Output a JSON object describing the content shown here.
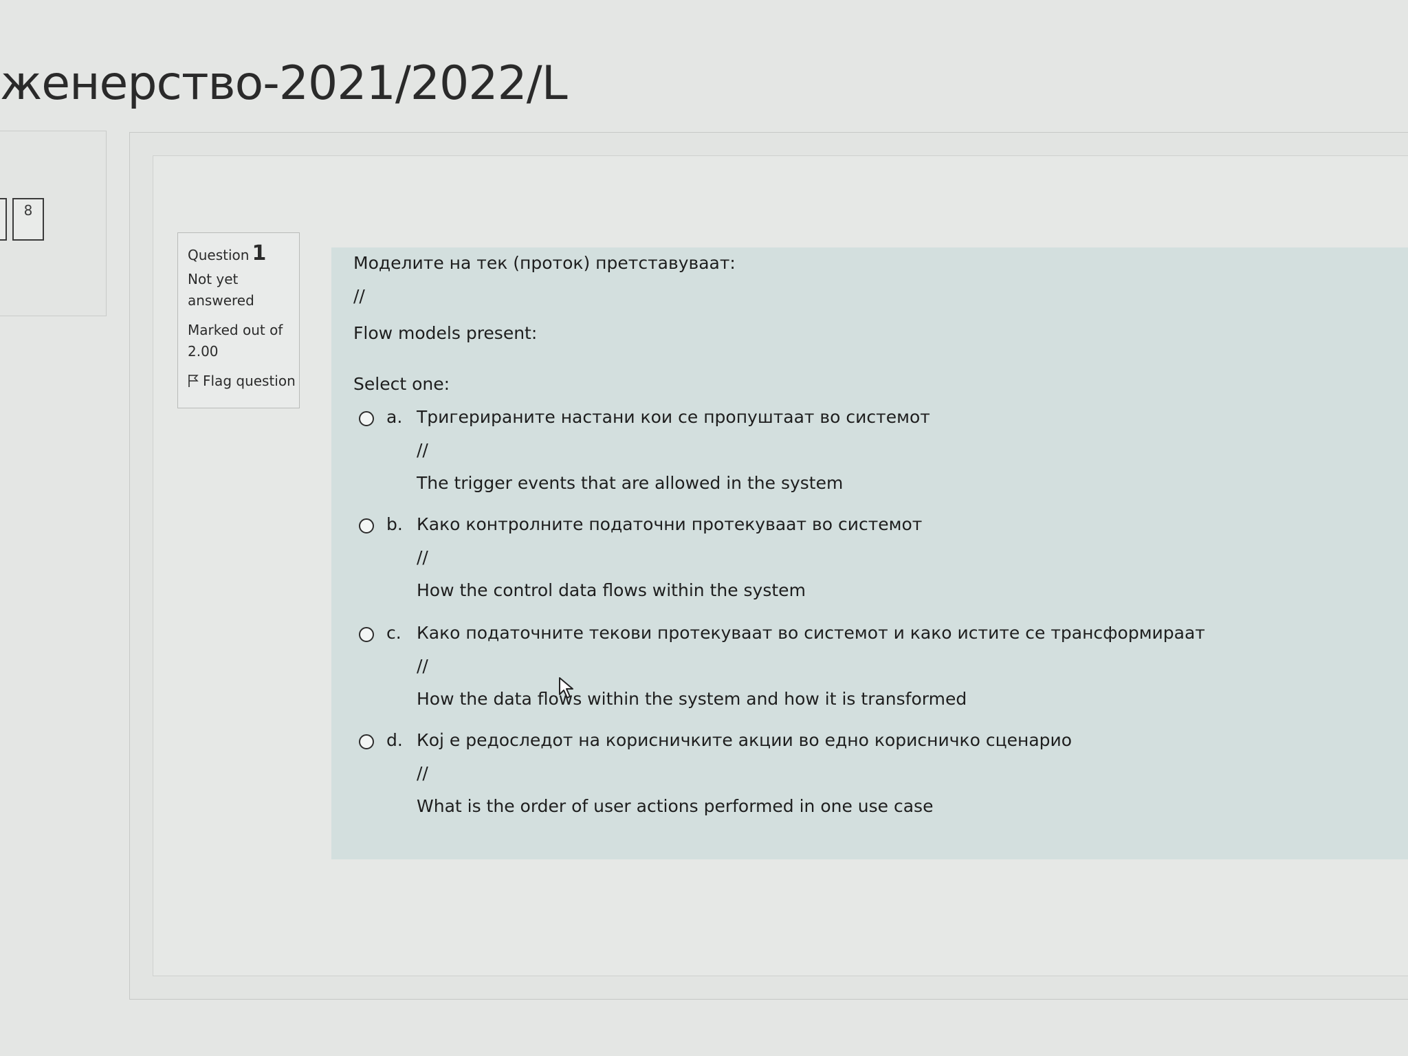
{
  "page": {
    "title": "женерство-2021/2022/L"
  },
  "quiz_nav": {
    "buttons": [
      {
        "label": ""
      },
      {
        "label": "8"
      }
    ]
  },
  "question_info": {
    "question_label": "Question",
    "question_number": "1",
    "state_line1": "Not yet",
    "state_line2": "answered",
    "marked_line1": "Marked out of",
    "marked_line2": "2.00",
    "flag_label": "Flag question"
  },
  "question": {
    "text_mk": "Моделите на тек (проток) претставуваат:",
    "separator": "//",
    "text_en": "Flow models present:",
    "prompt": "Select one:",
    "answers": [
      {
        "letter": "a.",
        "text_mk": "Тригерираните настани кои се пропуштаат во системот",
        "separator": "//",
        "text_en": "The trigger events that are allowed in the system"
      },
      {
        "letter": "b.",
        "text_mk": "Како контролните податочни протекуваат во системот",
        "separator": "//",
        "text_en": "How the control data flows within the system"
      },
      {
        "letter": "c.",
        "text_mk": "Како податочните текови протекуваат во системот и како истите се трансформираат",
        "separator": "//",
        "text_en": "How the data flows within the system and how it is transformed"
      },
      {
        "letter": "d.",
        "text_mk": "Кој е редоследот на корисничките акции во едно корисничко сценарио",
        "separator": "//",
        "text_en": "What is the order of user actions performed in one use case"
      }
    ]
  },
  "icons": {
    "flag": "flag-icon",
    "cursor": "mouse-pointer-icon"
  },
  "colors": {
    "question_bg": "#d3dfde",
    "page_bg": "#e4e6e4"
  }
}
